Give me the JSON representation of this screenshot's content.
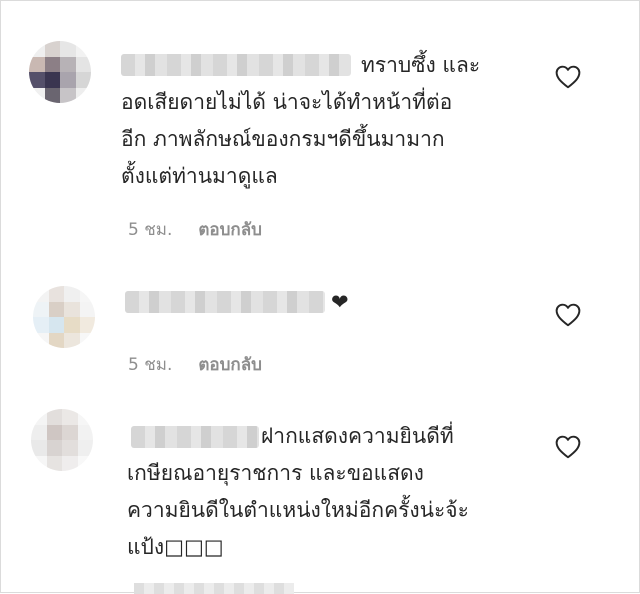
{
  "comments": [
    {
      "text": "ทราบซึ้ง และ\nอดเสียดายไม่ได้ น่าจะได้ทำหน้าที่ต่อ\nอีก ภาพลักษณ์ของกรมฯดีขึ้นมามาก\nตั้งแต่ท่านมาดูแล",
      "time": "5 ชม.",
      "reply": "ตอบกลับ"
    },
    {
      "text": "❤",
      "time": "5 ชม.",
      "reply": "ตอบกลับ"
    },
    {
      "text": "ฝากแสดงความยินดีที่\nเกษียณอายุราชการ และขอแสดง\nความยินดีในตำแหน่งใหม่อีกครั้งน่ะจ้ะ\nแป้ง□□□"
    }
  ],
  "icons": {
    "like": "heart-outline-icon"
  },
  "colors": {
    "text": "#262626",
    "meta": "#8e8e8e",
    "border": "#dbdbdb"
  }
}
